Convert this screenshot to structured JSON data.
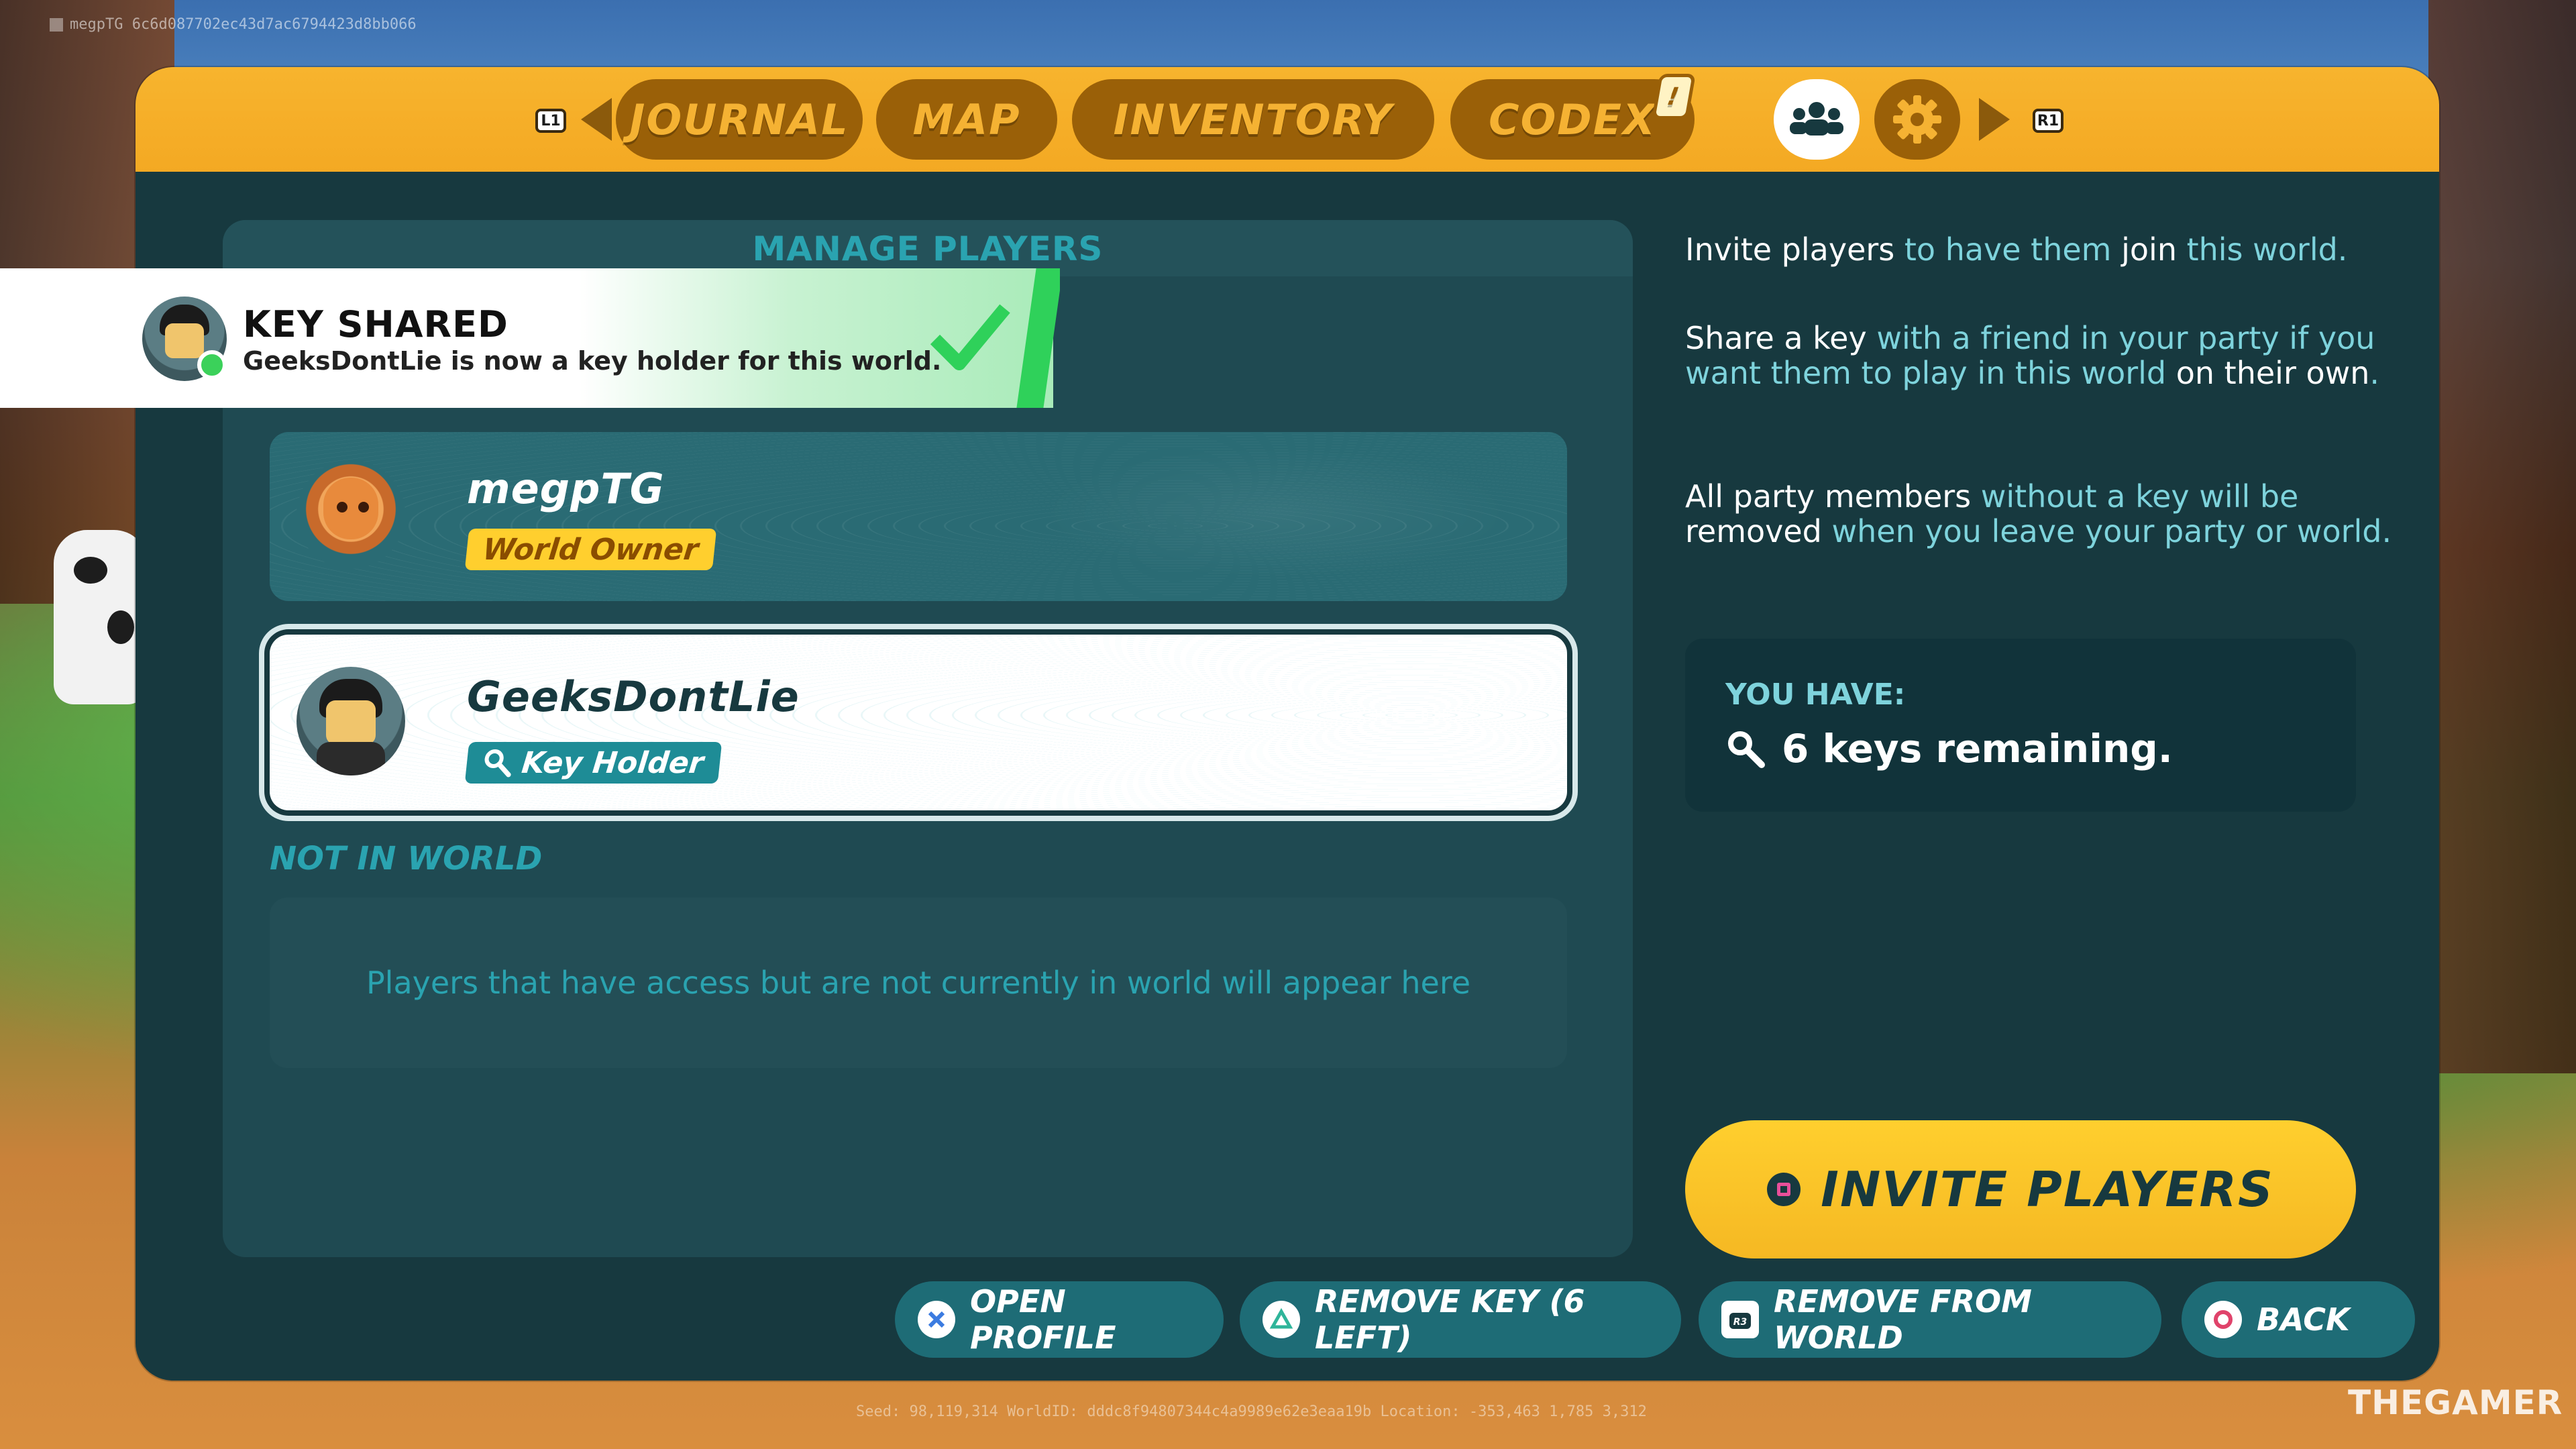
{
  "debug": {
    "top_label": "megpTG  6c6d087702ec43d7ac6794423d8bb066",
    "bottom_label": "Seed: 98,119,314    WorldID:   dddc8f94807344c4a9989e62e3eaa19b    Location: -353,463  1,785  3,312"
  },
  "nav": {
    "left_shoulder": "L1",
    "right_shoulder": "R1",
    "tabs": [
      {
        "label": "JOURNAL"
      },
      {
        "label": "MAP"
      },
      {
        "label": "INVENTORY"
      },
      {
        "label": "CODEX",
        "badge": "!"
      }
    ],
    "icon_tabs": [
      {
        "icon": "players-icon",
        "active": true
      },
      {
        "icon": "gear-icon",
        "active": false
      }
    ]
  },
  "toast": {
    "title": "KEY SHARED",
    "message": "GeeksDontLie is now a key holder for this world.",
    "status": "online",
    "icon": "checkmark-icon"
  },
  "manage": {
    "title": "MANAGE PLAYERS",
    "players": [
      {
        "name": "megpTG",
        "role": "World Owner",
        "avatar": "fox-avatar"
      },
      {
        "name": "GeeksDontLie",
        "role": "Key Holder",
        "avatar": "minifig-avatar",
        "selected": true
      }
    ],
    "not_in_world_label": "NOT IN WORLD",
    "not_in_world_empty": "Players that have access but are not currently in world will appear here"
  },
  "info": {
    "p1": [
      "Invite players",
      " to have them ",
      "join",
      " this world."
    ],
    "p2": [
      "Share a key",
      " with a friend in your party if you want them to play in this world ",
      "on their own",
      "."
    ],
    "p3": [
      "All party members",
      " without a key will be ",
      "removed",
      " when you leave your party or world."
    ]
  },
  "keys": {
    "label": "YOU HAVE:",
    "value": "6 keys remaining."
  },
  "invite_button": "INVITE PLAYERS",
  "actions": [
    {
      "label": "OPEN PROFILE",
      "glyph": "cross-button-icon"
    },
    {
      "label": "REMOVE KEY (6 LEFT)",
      "glyph": "triangle-button-icon"
    },
    {
      "label": "REMOVE FROM WORLD",
      "glyph": "r3-button-icon"
    },
    {
      "label": "BACK",
      "glyph": "circle-button-icon"
    }
  ],
  "watermark": "THEGAMER",
  "colors": {
    "accent_orange": "#f4a923",
    "panel_dark_teal": "#17393f",
    "teal_text": "#2aa3b0",
    "owner_badge": "#ffcf2e",
    "key_badge": "#1e8c96",
    "toast_check": "#2fd15a"
  }
}
